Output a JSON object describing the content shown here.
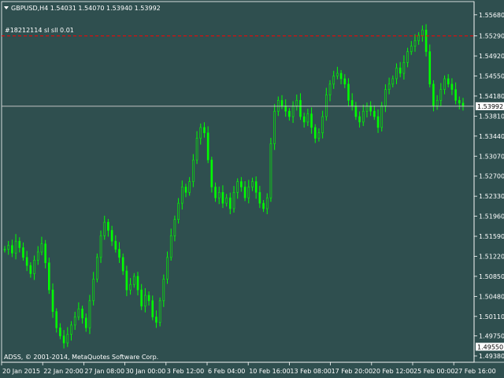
{
  "header": {
    "symbol_line": "GBPUSD,H4  1.54031 1.54070 1.53940 1.53992",
    "order_label": "#18212114 sl sll 0.01",
    "copyright": "ADSS, © 2001-2014, MetaQuotes Software Corp."
  },
  "colors": {
    "background": "#2f4f4f",
    "candles": "#00ff00",
    "bid_line": "#c0c0c0",
    "order_line": "#ff0000",
    "text": "#ffffff"
  },
  "chart_data": {
    "type": "candlestick",
    "symbol": "GBPUSD",
    "timeframe": "H4",
    "last_ohlc": {
      "open": 1.54031,
      "high": 1.5407,
      "low": 1.5394,
      "close": 1.53992
    },
    "current_bid": "1.53992",
    "order": {
      "ticket": "#18212114",
      "type": "sell",
      "lots": 0.01,
      "price": 1.5529
    },
    "ylim": [
      1.4938,
      1.5575
    ],
    "y_ticks": [
      "1.55680",
      "1.55290",
      "1.54920",
      "1.54550",
      "1.54180",
      "1.53810",
      "1.53440",
      "1.53070",
      "1.52700",
      "1.52330",
      "1.51960",
      "1.51590",
      "1.51220",
      "1.50850",
      "1.50480",
      "1.50110",
      "1.49750",
      "1.49380"
    ],
    "low_marker": "1.49550",
    "x_tick_labels": [
      "20 Jan 2015",
      "22 Jan 20:00",
      "27 Jan 08:00",
      "30 Jan 00:00",
      "3 Feb 12:00",
      "6 Feb 04:00",
      "10 Feb 16:00",
      "13 Feb 08:00",
      "17 Feb 20:00",
      "20 Feb 12:00",
      "25 Feb 00:00",
      "27 Feb 16:00"
    ],
    "close_path": [
      1.5135,
      1.5142,
      1.5128,
      1.515,
      1.5138,
      1.512,
      1.5105,
      1.509,
      1.5115,
      1.513,
      1.5145,
      1.511,
      1.506,
      1.502,
      1.499,
      1.4975,
      1.4962,
      1.4978,
      1.4995,
      1.501,
      1.5025,
      1.5008,
      1.499,
      1.504,
      1.508,
      1.512,
      1.516,
      1.5185,
      1.517,
      1.515,
      1.5135,
      1.512,
      1.5095,
      1.506,
      1.507,
      1.5085,
      1.506,
      1.503,
      1.505,
      1.504,
      1.501,
      1.5,
      1.504,
      1.508,
      1.512,
      1.516,
      1.519,
      1.522,
      1.525,
      1.524,
      1.526,
      1.53,
      1.534,
      1.536,
      1.535,
      1.53,
      1.525,
      1.523,
      1.524,
      1.522,
      1.523,
      1.521,
      1.524,
      1.526,
      1.525,
      1.523,
      1.525,
      1.526,
      1.524,
      1.522,
      1.521,
      1.523,
      1.533,
      1.539,
      1.541,
      1.54,
      1.539,
      1.538,
      1.54,
      1.541,
      1.538,
      1.537,
      1.5385,
      1.536,
      1.534,
      1.535,
      1.538,
      1.542,
      1.544,
      1.5455,
      1.546,
      1.545,
      1.544,
      1.541,
      1.54,
      1.538,
      1.537,
      1.539,
      1.54,
      1.539,
      1.538,
      1.536,
      1.54,
      1.543,
      1.544,
      1.545,
      1.547,
      1.546,
      1.548,
      1.55,
      1.551,
      1.552,
      1.553,
      1.554,
      1.55,
      1.544,
      1.54,
      1.541,
      1.543,
      1.545,
      1.544,
      1.543,
      1.541,
      1.5405,
      1.54
    ]
  }
}
